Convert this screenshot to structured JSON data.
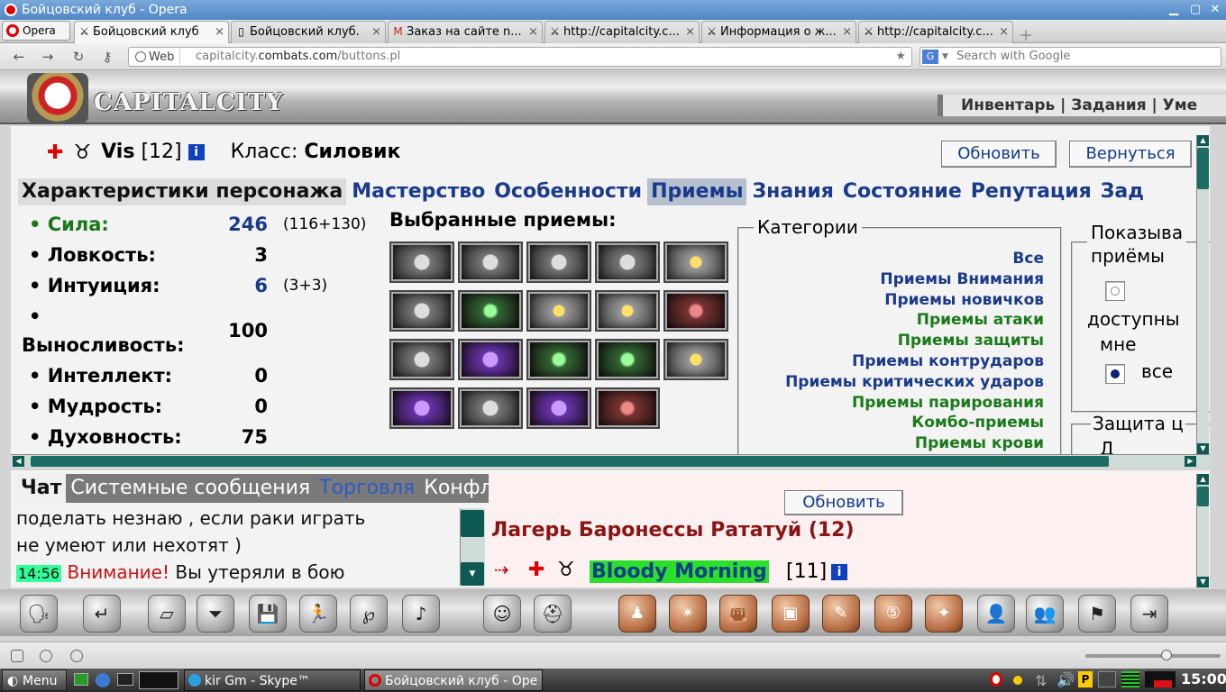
{
  "window": {
    "title": "Бойцовский клуб - Opera"
  },
  "browser": {
    "menu_label": "Opera",
    "tabs": [
      {
        "label": "Бойцовский клуб",
        "icon": "crossed-swords-icon",
        "active": true
      },
      {
        "label": "Бойцовский клуб.",
        "icon": "page-icon"
      },
      {
        "label": "Заказ на сайте n...",
        "icon": "gmail-icon"
      },
      {
        "label": "http://capitalcity.c...",
        "icon": "crossed-swords-icon"
      },
      {
        "label": "Информация о ж...",
        "icon": "crossed-swords-icon"
      },
      {
        "label": "http://capitalcity.c...",
        "icon": "crossed-swords-icon"
      }
    ],
    "address": {
      "scheme_label": "Web",
      "url_prefix": "capitalcity.",
      "url_domain": "combats.com",
      "url_path": "/buttons.pl"
    },
    "search": {
      "engine": "G",
      "placeholder": "Search with Google"
    }
  },
  "game": {
    "logo_text": "CAPITALCITY",
    "top_nav": "Инвентарь | Задания | Уме",
    "player": {
      "name": "Vis",
      "level": "[12]",
      "class_label": "Класс:",
      "class_value": "Силовик"
    },
    "buttons": {
      "refresh": "Обновить",
      "back": "Вернуться"
    },
    "tabs": [
      "Характеристики персонажа",
      "Мастерство",
      "Особенности",
      "Приемы",
      "Знания",
      "Состояние",
      "Репутация",
      "Зад"
    ],
    "stats": [
      {
        "label": "• Сила:",
        "value": "246",
        "extra": "(116+130)",
        "color": "#1a7a1a",
        "value_color": "#1a3a8a"
      },
      {
        "label": "• Ловкость:",
        "value": "3",
        "extra": "",
        "color": "#111",
        "value_color": "#111"
      },
      {
        "label": "• Интуиция:",
        "value": "6",
        "extra": "(3+3)",
        "color": "#111",
        "value_color": "#1a3a8a"
      },
      {
        "label": "•",
        "value": "",
        "extra": "",
        "color": "#111",
        "value_color": "#111"
      },
      {
        "label": "Выносливость:",
        "value": "100",
        "extra": "",
        "color": "#111",
        "value_color": "#111"
      },
      {
        "label": "• Интеллект:",
        "value": "0",
        "extra": "",
        "color": "#111",
        "value_color": "#111"
      },
      {
        "label": "• Мудрость:",
        "value": "0",
        "extra": "",
        "color": "#111",
        "value_color": "#111"
      },
      {
        "label": "• Духовность:",
        "value": "75",
        "extra": "",
        "color": "#111",
        "value_color": "#111"
      }
    ],
    "picked_title": "Выбранные приемы:",
    "categories_title": "Категории",
    "categories": [
      {
        "label": "Все",
        "color": "#1a3a8a"
      },
      {
        "label": "Приемы Внимания",
        "color": "#1a3a8a"
      },
      {
        "label": "Приемы новичков",
        "color": "#1a3a8a"
      },
      {
        "label": "Приемы атаки",
        "color": "#1a7a1a"
      },
      {
        "label": "Приемы защиты",
        "color": "#1a7a1a"
      },
      {
        "label": "Приемы контрударов",
        "color": "#1a3a8a"
      },
      {
        "label": "Приемы критических ударов",
        "color": "#1a3a8a"
      },
      {
        "label": "Приемы парирования",
        "color": "#1a7a1a"
      },
      {
        "label": "Комбо-приемы",
        "color": "#1a7a1a"
      },
      {
        "label": "Приемы крови",
        "color": "#1a7a1a"
      }
    ],
    "show_title": "Показыва",
    "show_line2": "приёмы",
    "show_available": "доступны",
    "show_available2": "мне",
    "show_all": "все",
    "protection_title": "Защита ц",
    "protection_more": "Д"
  },
  "chat": {
    "tabs": [
      "Чат",
      "Системные сообщения",
      "Торговля",
      "Конфликты"
    ],
    "lines": [
      {
        "text": "поделать незнаю , если раки играть"
      },
      {
        "text": "не умеют или нехотят )"
      }
    ],
    "time": "14:56",
    "warning": "Внимание!",
    "message": "Вы утеряли в бою",
    "refresh_label": "Обновить",
    "room": "Лагерь Баронессы Рататуй (12)",
    "player_name": "Bloody Morning",
    "player_level": "[11]"
  },
  "taskbar": {
    "menu": "Menu",
    "tasks": [
      "kir Gm - Skype™",
      "Бойцовский клуб - Ope"
    ],
    "clock": "15:00"
  }
}
